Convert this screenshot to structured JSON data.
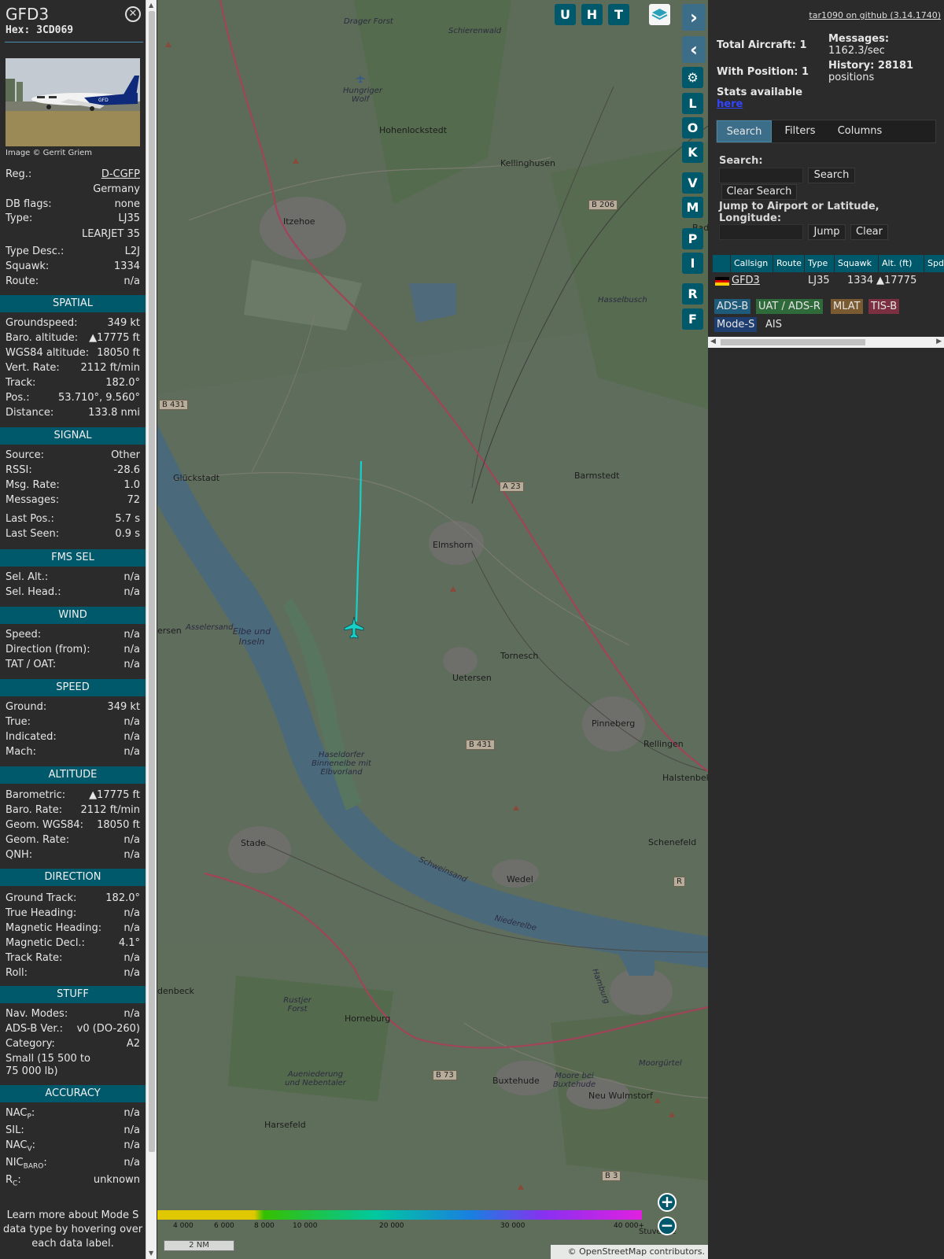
{
  "aircraft": {
    "callsign": "GFD3",
    "hex_label": "Hex: 3CD069",
    "photo_credit": "Image © Gerrit Griem",
    "reg_label": "Reg.:",
    "reg": "D-CGFP",
    "country": "Germany",
    "dbflags_label": "DB flags:",
    "dbflags": "none",
    "type_label": "Type:",
    "type": "LJ35",
    "type_full": "LEARJET 35",
    "typedesc_label": "Type Desc.:",
    "typedesc": "L2J",
    "squawk_label": "Squawk:",
    "squawk": "1334",
    "route_label": "Route:",
    "route": "n/a"
  },
  "spatial": {
    "header": "SPATIAL",
    "rows": [
      {
        "k": "Groundspeed:",
        "v": "349 kt"
      },
      {
        "k": "Baro. altitude:",
        "v": "▲17775 ft"
      },
      {
        "k": "WGS84 altitude:",
        "v": "18050 ft"
      },
      {
        "k": "Vert. Rate:",
        "v": "2112 ft/min"
      },
      {
        "k": "Track:",
        "v": "182.0°"
      },
      {
        "k": "Pos.:",
        "v": "53.710°, 9.560°"
      },
      {
        "k": "Distance:",
        "v": "133.8 nmi"
      }
    ]
  },
  "signal": {
    "header": "SIGNAL",
    "rows": [
      {
        "k": "Source:",
        "v": "Other"
      },
      {
        "k": "RSSI:",
        "v": "-28.6"
      },
      {
        "k": "Msg. Rate:",
        "v": "1.0"
      },
      {
        "k": "Messages:",
        "v": "72"
      },
      {
        "k": "Last Pos.:",
        "v": "5.7 s"
      },
      {
        "k": "Last Seen:",
        "v": "0.9 s"
      }
    ]
  },
  "fms": {
    "header": "FMS SEL",
    "rows": [
      {
        "k": "Sel. Alt.:",
        "v": "n/a"
      },
      {
        "k": "Sel. Head.:",
        "v": "n/a"
      }
    ]
  },
  "wind": {
    "header": "WIND",
    "rows": [
      {
        "k": "Speed:",
        "v": "n/a"
      },
      {
        "k": "Direction (from):",
        "v": "n/a"
      },
      {
        "k": "TAT / OAT:",
        "v": "n/a"
      }
    ]
  },
  "speed": {
    "header": "SPEED",
    "rows": [
      {
        "k": "Ground:",
        "v": "349 kt"
      },
      {
        "k": "True:",
        "v": "n/a"
      },
      {
        "k": "Indicated:",
        "v": "n/a"
      },
      {
        "k": "Mach:",
        "v": "n/a"
      }
    ]
  },
  "altitude": {
    "header": "ALTITUDE",
    "rows": [
      {
        "k": "Barometric:",
        "v": "▲17775 ft"
      },
      {
        "k": "Baro. Rate:",
        "v": "2112 ft/min"
      },
      {
        "k": "Geom. WGS84:",
        "v": "18050 ft"
      },
      {
        "k": "Geom. Rate:",
        "v": "n/a"
      },
      {
        "k": "QNH:",
        "v": "n/a"
      }
    ]
  },
  "direction": {
    "header": "DIRECTION",
    "rows": [
      {
        "k": "Ground Track:",
        "v": "182.0°"
      },
      {
        "k": "True Heading:",
        "v": "n/a"
      },
      {
        "k": "Magnetic Heading:",
        "v": "n/a"
      },
      {
        "k": "Magnetic Decl.:",
        "v": "4.1°"
      },
      {
        "k": "Track Rate:",
        "v": "n/a"
      },
      {
        "k": "Roll:",
        "v": "n/a"
      }
    ]
  },
  "stuff": {
    "header": "STUFF",
    "rows": [
      {
        "k": "Nav. Modes:",
        "v": "n/a"
      },
      {
        "k": "ADS-B Ver.:",
        "v": "v0 (DO-260)"
      },
      {
        "k": "Category:",
        "v": "A2"
      }
    ],
    "category_desc": "Small (15 500 to 75 000 lb)"
  },
  "accuracy": {
    "header": "ACCURACY",
    "nacp_k": "NAC",
    "nacp_sub": "P",
    "nacp_v": "n/a",
    "sil_k": "SIL:",
    "sil_v": "n/a",
    "nacv_k": "NAC",
    "nacv_sub": "V",
    "nacv_v": "n/a",
    "nicbaro_k": "NIC",
    "nicbaro_sub": "BARO",
    "nicbaro_v": "n/a",
    "rc_k": "R",
    "rc_sub": "C",
    "rc_v": "unknown"
  },
  "footnote": "Learn more about Mode S data type by hovering over each data label.",
  "map_buttons": {
    "u": "U",
    "h": "H",
    "t": "T",
    "l": "L",
    "o": "O",
    "k": "K",
    "v": "V",
    "m": "M",
    "p": "P",
    "i": "I",
    "r": "R",
    "f": "F"
  },
  "map_labels": {
    "drager_forst": "Drager Forst",
    "schierenwald": "Schierenwald",
    "hungriger_wolf": "Hungriger Wolf",
    "hohenlockstedt": "Hohenlockstedt",
    "kellinghusen": "Kellinghusen",
    "itzehoe": "Itzehoe",
    "hasselbusch": "Hasselbusch",
    "glueckstadt": "Glückstadt",
    "barmstedt": "Barmstedt",
    "elmshorn": "Elmshorn",
    "asselersand": "Asselersand",
    "elbe_inseln": "Elbe und Inseln",
    "ersen": "ersen",
    "tornesch": "Tornesch",
    "uetersen": "Uetersen",
    "pinneberg": "Pinneberg",
    "rellingen": "Rellingen",
    "halstenbek": "Halstenbek",
    "haseldorfer": "Haseldorfer Binnenelbe mit Elbvorland",
    "schenefeld": "Schenefeld",
    "stade": "Stade",
    "wedel": "Wedel",
    "schwinge": "Schweinsand",
    "niederelbe": "Niederelbe",
    "hamburg": "Hamburg",
    "denbeck": "denbeck",
    "rustjer_forst": "Rustjer Forst",
    "horneburg": "Horneburg",
    "moorgurtel": "Moorgürtel",
    "aueniederung": "Aueniederung und Nebentaler",
    "buxtehude": "Buxtehude",
    "moore_buxtehude": "Moore bei Buxtehude",
    "neu_wulmstorf": "Neu Wulmstorf",
    "harsefeld": "Harsefeld",
    "bad": "Bad",
    "stuvenge": "Stuvenge",
    "b206": "B 206",
    "b431a": "B 431",
    "a23": "A 23",
    "b431b": "B 431",
    "b73": "B 73",
    "b3": "B 3",
    "r": "R"
  },
  "altitude_scale": [
    "4 000",
    "6 000",
    "8 000",
    "10 000",
    "20 000",
    "30 000",
    "40 000+"
  ],
  "nm_scale": "2 NM",
  "attribution": "© OpenStreetMap contributors.",
  "side": {
    "github": "tar1090 on github (3.14.1740)",
    "total_aircraft": "Total Aircraft: 1",
    "messages_label": "Messages:",
    "messages_rate": "1162.3/sec",
    "with_position": "With Position: 1",
    "history_label": "History: 28181",
    "history_unit": "positions",
    "stats_label": "Stats available",
    "stats_link": "here",
    "tabs": [
      "Search",
      "Filters",
      "Columns"
    ],
    "search_label": "Search:",
    "search_button": "Search",
    "clear_search": "Clear Search",
    "jump_label": "Jump to Airport or Latitude, Longitude:",
    "jump_button": "Jump",
    "clear_button": "Clear",
    "columns": [
      "Callsign",
      "Route",
      "Type",
      "Squawk",
      "Alt. (ft)",
      "Spd"
    ],
    "row": {
      "callsign": "GFD3",
      "route": "",
      "type": "LJ35",
      "squawk": "1334",
      "alt": "▲17775"
    },
    "chips": [
      {
        "label": "ADS-B",
        "color": "#1e5a7a"
      },
      {
        "label": "UAT / ADS-R",
        "color": "#2e6a3a"
      },
      {
        "label": "MLAT",
        "color": "#7a5a30"
      },
      {
        "label": "TIS-B",
        "color": "#7a3040"
      },
      {
        "label": "Mode-S",
        "color": "#1f3e70"
      },
      {
        "label": "AIS",
        "color": "#2b2b2b"
      }
    ]
  }
}
